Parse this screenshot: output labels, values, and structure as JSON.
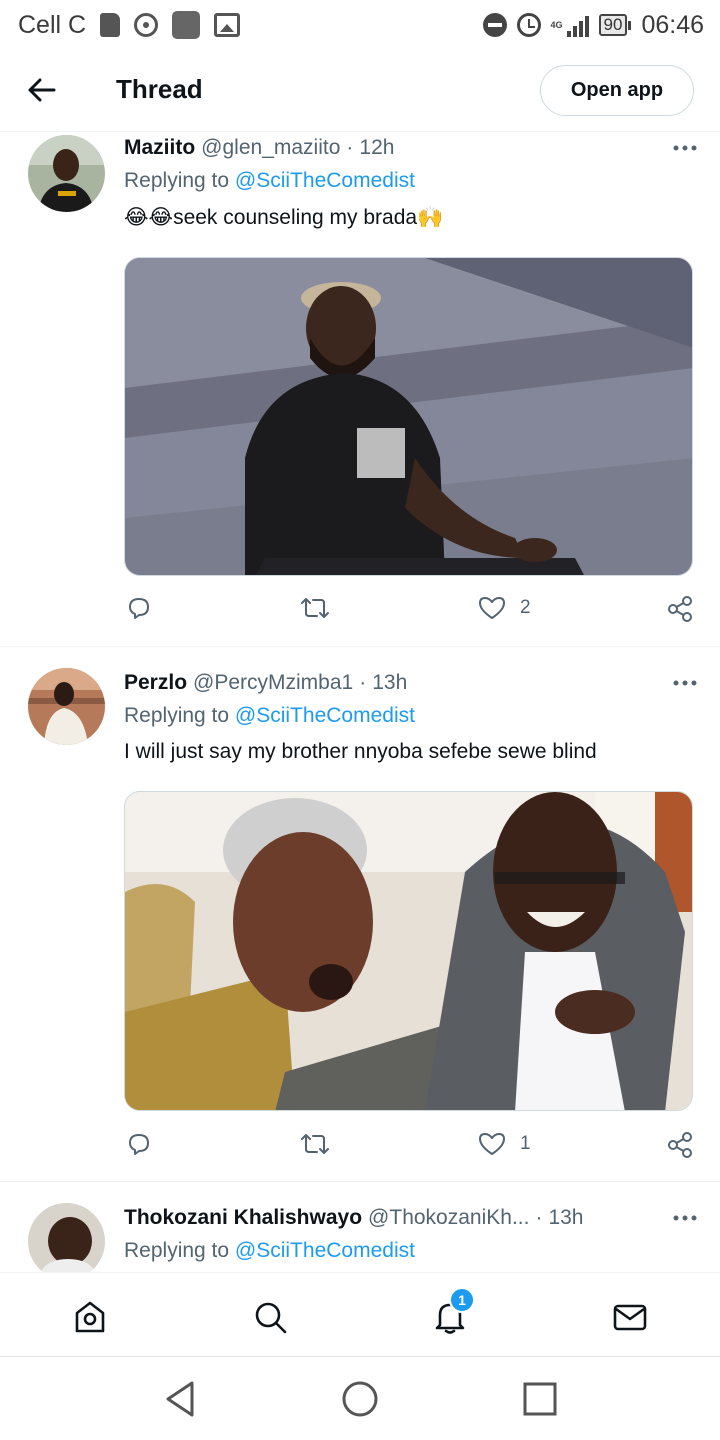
{
  "status_bar": {
    "carrier": "Cell C",
    "network": "4G",
    "battery": "90",
    "time": "06:46"
  },
  "header": {
    "title": "Thread",
    "open_app_label": "Open app"
  },
  "tweets": [
    {
      "name": "Maziito",
      "handle": "@glen_maziito",
      "separator": "·",
      "time": "12h",
      "reply_prefix": "Replying to",
      "reply_to": "@SciiTheComedist",
      "text": "😂😂seek counseling my brada🙌",
      "likes": "2",
      "media": "photo-man-seated-black-tshirt"
    },
    {
      "name": "Perzlo",
      "handle": "@PercyMzimba1",
      "separator": "·",
      "time": "13h",
      "reply_prefix": "Replying to",
      "reply_to": "@SciiTheComedist",
      "text": "I will just say my brother nnyoba sefebe sewe blind",
      "likes": "1",
      "media": "photo-two-men-laughing"
    },
    {
      "name": "Thokozani Khalishwayo",
      "handle": "@ThokozaniKh...",
      "separator": "·",
      "time": "13h",
      "reply_prefix": "Replying to",
      "reply_to": "@SciiTheComedist"
    }
  ],
  "bottom_nav": {
    "notification_count": "1",
    "icons": [
      "home-icon",
      "search-icon",
      "bell-icon",
      "mail-icon"
    ]
  },
  "colors": {
    "accent": "#1d9bf0",
    "text": "#0f1419",
    "secondary": "#536471"
  }
}
